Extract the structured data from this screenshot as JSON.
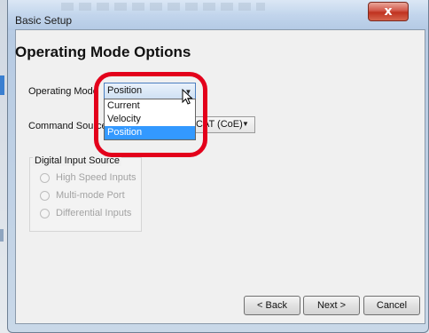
{
  "window": {
    "title": "Basic Setup",
    "close_glyph": "x"
  },
  "page": {
    "heading": "Operating Mode Options"
  },
  "operating_mode": {
    "label": "Operating Mode",
    "value": "Position",
    "options": [
      "Current",
      "Velocity",
      "Position"
    ],
    "selected_index": 2
  },
  "command_source": {
    "label": "Command Source:",
    "value": "CAT (CoE)"
  },
  "digital_input_source": {
    "title": "Digital Input Source",
    "options": [
      "High Speed Inputs",
      "Multi-mode Port",
      "Differential Inputs"
    ]
  },
  "buttons": {
    "back": "< Back",
    "next": "Next >",
    "cancel": "Cancel"
  },
  "colors": {
    "highlight": "#e3001b",
    "selection": "#3399ff"
  }
}
